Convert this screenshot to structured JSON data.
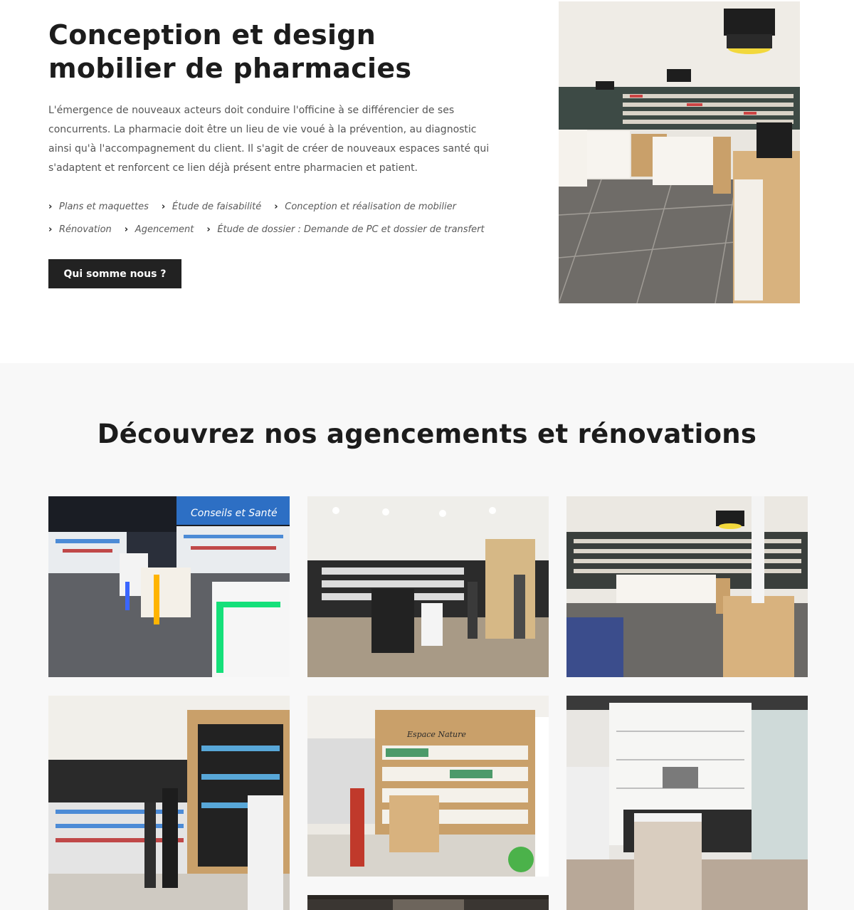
{
  "hero": {
    "title_line1": "Conception et design",
    "title_line2": "mobilier de pharmacies",
    "description": "L'émergence de nouveaux acteurs doit conduire l'officine à se différencier de ses concurrents. La pharmacie doit être un lieu de vie voué à la prévention, au diagnostic ainsi qu'à l'accompagnement du client. Il s'agit de créer de nouveaux espaces santé qui s'adaptent et renforcent ce lien déjà présent entre pharmacien et patient.",
    "services_row1": [
      "Plans et maquettes",
      "Étude de faisabilité",
      "Conception et réalisation de mobilier"
    ],
    "services_row2": [
      "Rénovation",
      "Agencement",
      "Étude de dossier : Demande de PC et dossier de transfert"
    ],
    "cta_label": "Qui somme nous ?",
    "photo_icon": "pharmacy-interior-photo"
  },
  "gallery": {
    "title": "Découvrez nos agencements et rénovations",
    "images": [
      {
        "icon": "pharmacy-counters-neon-photo",
        "sign_text": "Conseils et Santé"
      },
      {
        "icon": "pharmacy-store-customers-photo"
      },
      {
        "icon": "pharmacy-counters-lamps-photo"
      },
      {
        "icon": "pharmacy-shelves-customers-photo"
      },
      {
        "icon": "pharmacy-espace-nature-photo",
        "sign_text": "Espace Nature"
      },
      {
        "icon": "pharmacy-white-furniture-photo"
      },
      {
        "icon": "pharmacy-partial-photo"
      }
    ]
  },
  "colors": {
    "heading": "#1c1c1c",
    "body_text": "#555555",
    "button_bg": "#222222",
    "section_bg": "#f8f8f8",
    "wood": "#c9a06a"
  }
}
